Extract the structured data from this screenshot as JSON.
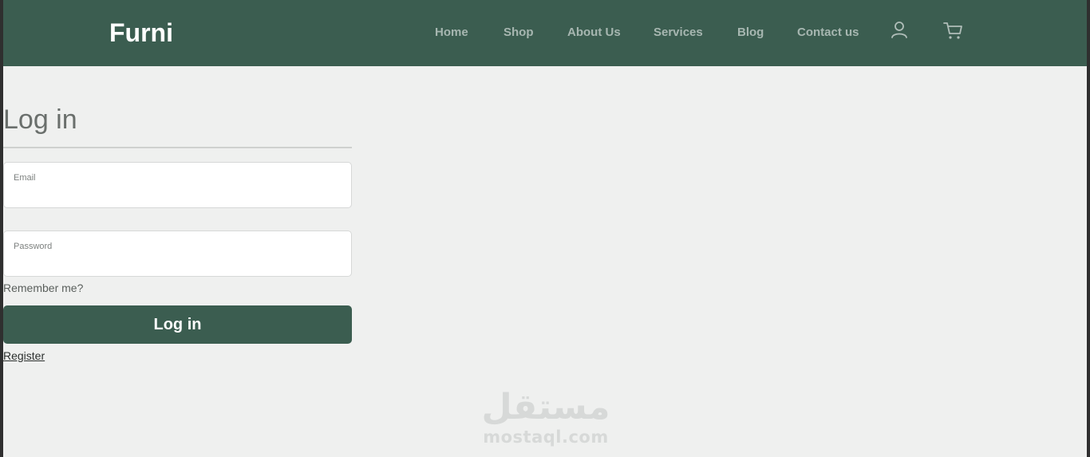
{
  "navbar": {
    "brand": "Furni",
    "links": [
      {
        "label": "Home"
      },
      {
        "label": "Shop"
      },
      {
        "label": "About Us"
      },
      {
        "label": "Services"
      },
      {
        "label": "Blog"
      },
      {
        "label": "Contact us"
      }
    ],
    "icons": [
      "user-icon",
      "cart-icon"
    ],
    "background_color": "#3b5d50"
  },
  "login": {
    "title": "Log in",
    "email": {
      "label": "Email",
      "value": ""
    },
    "password": {
      "label": "Password",
      "value": ""
    },
    "remember_label": "Remember me?",
    "submit_label": "Log in",
    "register_label": "Register"
  },
  "watermark": {
    "arabic": "مستقل",
    "latin": "mostaql.com"
  }
}
